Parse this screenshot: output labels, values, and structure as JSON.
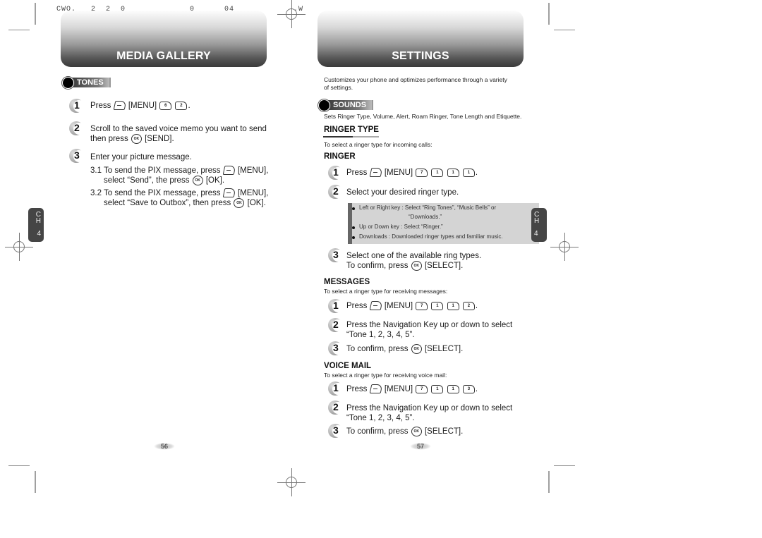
{
  "print_header": "CWO.   2  2  0             0      04            .W",
  "left_page": {
    "banner_title": "MEDIA GALLERY",
    "section_label": "TONES",
    "steps": [
      {
        "number": "1",
        "parts": [
          "Press",
          "[MENU]",
          "."
        ]
      },
      {
        "number": "2",
        "line1": "Scroll to the saved voice memo you want to send",
        "line2_pre": "then press",
        "line2_post": "[SEND]."
      },
      {
        "number": "3",
        "text": "Enter your picture message."
      }
    ],
    "substeps": [
      {
        "line1_pre": "3.1 To send the PIX message, press",
        "line1_post": "[MENU],",
        "line2_pre": "select “Send”, the press",
        "line2_post": "[OK]."
      },
      {
        "line1_pre": "3.2 To send the PIX message, press",
        "line1_post": "[MENU],",
        "line2_pre": "select “Save to Outbox”, then press",
        "line2_post": "[OK]."
      }
    ],
    "keys_step1": [
      "6",
      "2"
    ],
    "chapter_tab": {
      "letters": [
        "C",
        "H"
      ],
      "number": "4"
    },
    "page_number": "56"
  },
  "right_page": {
    "banner_title": "SETTINGS",
    "intro_line1": "Customizes your phone and optimizes performance through a variety",
    "intro_line2": "of settings.",
    "section_label": "SOUNDS",
    "section_desc": "Sets Ringer Type, Volume, Alert, Roam Ringer, Tone Length and Etiquette.",
    "ringer_type": {
      "heading": "RINGER TYPE",
      "desc": "To select a ringer type for incoming calls:"
    },
    "ringer": {
      "heading": "RINGER",
      "step1_pre": "Press",
      "step1_menu": "[MENU]",
      "step1_keys": [
        "7",
        "1",
        "1",
        "1"
      ],
      "step2": "Select your desired ringer type.",
      "notes": [
        {
          "line1": "Left or Right key : Select “Ring Tones”, “Music Bells” or",
          "line2": "“Downloads.”"
        },
        {
          "line1": "Up or Down key : Select “Ringer.”"
        },
        {
          "line1": "Downloads : Downloaded ringer types and familiar music."
        }
      ],
      "step3_line1": "Select one of the available ring types.",
      "step3_pre": "To confirm, press",
      "step3_post": "[SELECT]."
    },
    "messages": {
      "heading": "MESSAGES",
      "desc": "To select a ringer type for receiving messages:",
      "step1_pre": "Press",
      "step1_menu": "[MENU]",
      "step1_keys": [
        "7",
        "1",
        "1",
        "2"
      ],
      "step2_line1": "Press the Navigation Key up or down to select",
      "step2_line2": "“Tone 1, 2, 3, 4, 5”.",
      "step3_pre": "To confirm, press",
      "step3_post": "[SELECT]."
    },
    "voice_mail": {
      "heading": "VOICE MAIL",
      "desc": "To select a ringer type for receiving voice mail:",
      "step1_pre": "Press",
      "step1_menu": "[MENU]",
      "step1_keys": [
        "7",
        "1",
        "1",
        "3"
      ],
      "step2_line1": "Press the Navigation Key up or down to select",
      "step2_line2": "“Tone 1, 2, 3, 4, 5”.",
      "step3_pre": "To confirm, press",
      "step3_post": "[SELECT]."
    },
    "chapter_tab": {
      "letters": [
        "C",
        "H"
      ],
      "number": "4"
    },
    "page_number": "57"
  },
  "ok_key_label": "OK"
}
